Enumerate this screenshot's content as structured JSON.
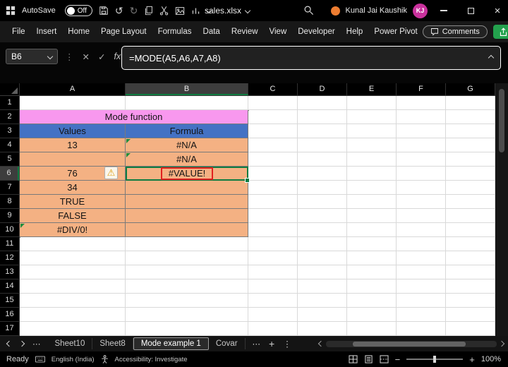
{
  "colors": {
    "title_pink": "#F898EE",
    "header_blue": "#4472C4",
    "table_orange": "#F4B183",
    "selection_green": "#107C41",
    "annotation_red": "#E02020"
  },
  "title_bar": {
    "autosave_label": "AutoSave",
    "autosave_state": "Off",
    "file_name": "sales.xlsx",
    "user_name": "Kunal Jai Kaushik",
    "user_initials": "KJ"
  },
  "ribbon": {
    "tabs": [
      "File",
      "Insert",
      "Home",
      "Page Layout",
      "Formulas",
      "Data",
      "Review",
      "View",
      "Developer",
      "Help",
      "Power Pivot"
    ],
    "comments_label": "Comments"
  },
  "formula_bar": {
    "name_box": "B6",
    "formula": "=MODE(A5,A6,A7,A8)"
  },
  "grid": {
    "columns": [
      "A",
      "B",
      "C",
      "D",
      "E",
      "F",
      "G"
    ],
    "row_numbers": [
      "1",
      "2",
      "3",
      "4",
      "5",
      "6",
      "7",
      "8",
      "9",
      "10",
      "11",
      "12",
      "13",
      "14",
      "15",
      "16",
      "17"
    ],
    "selected_cell": "B6",
    "table": {
      "title": "Mode function",
      "col_a_header": "Values",
      "col_b_header": "Formula",
      "rows": [
        {
          "a": "13",
          "b": "#N/A"
        },
        {
          "a": "",
          "b": "#N/A"
        },
        {
          "a": "76",
          "b": "#VALUE!"
        },
        {
          "a": "34",
          "b": ""
        },
        {
          "a": "TRUE",
          "b": ""
        },
        {
          "a": "FALSE",
          "b": ""
        },
        {
          "a": "#DIV/0!",
          "b": ""
        }
      ]
    }
  },
  "sheet_tabs": {
    "tabs": [
      "Sheet10",
      "Sheet8",
      "Mode example 1",
      "Covar"
    ],
    "active": "Mode example 1"
  },
  "status_bar": {
    "ready": "Ready",
    "language": "English (India)",
    "accessibility": "Accessibility: Investigate",
    "zoom_level": "100%"
  }
}
